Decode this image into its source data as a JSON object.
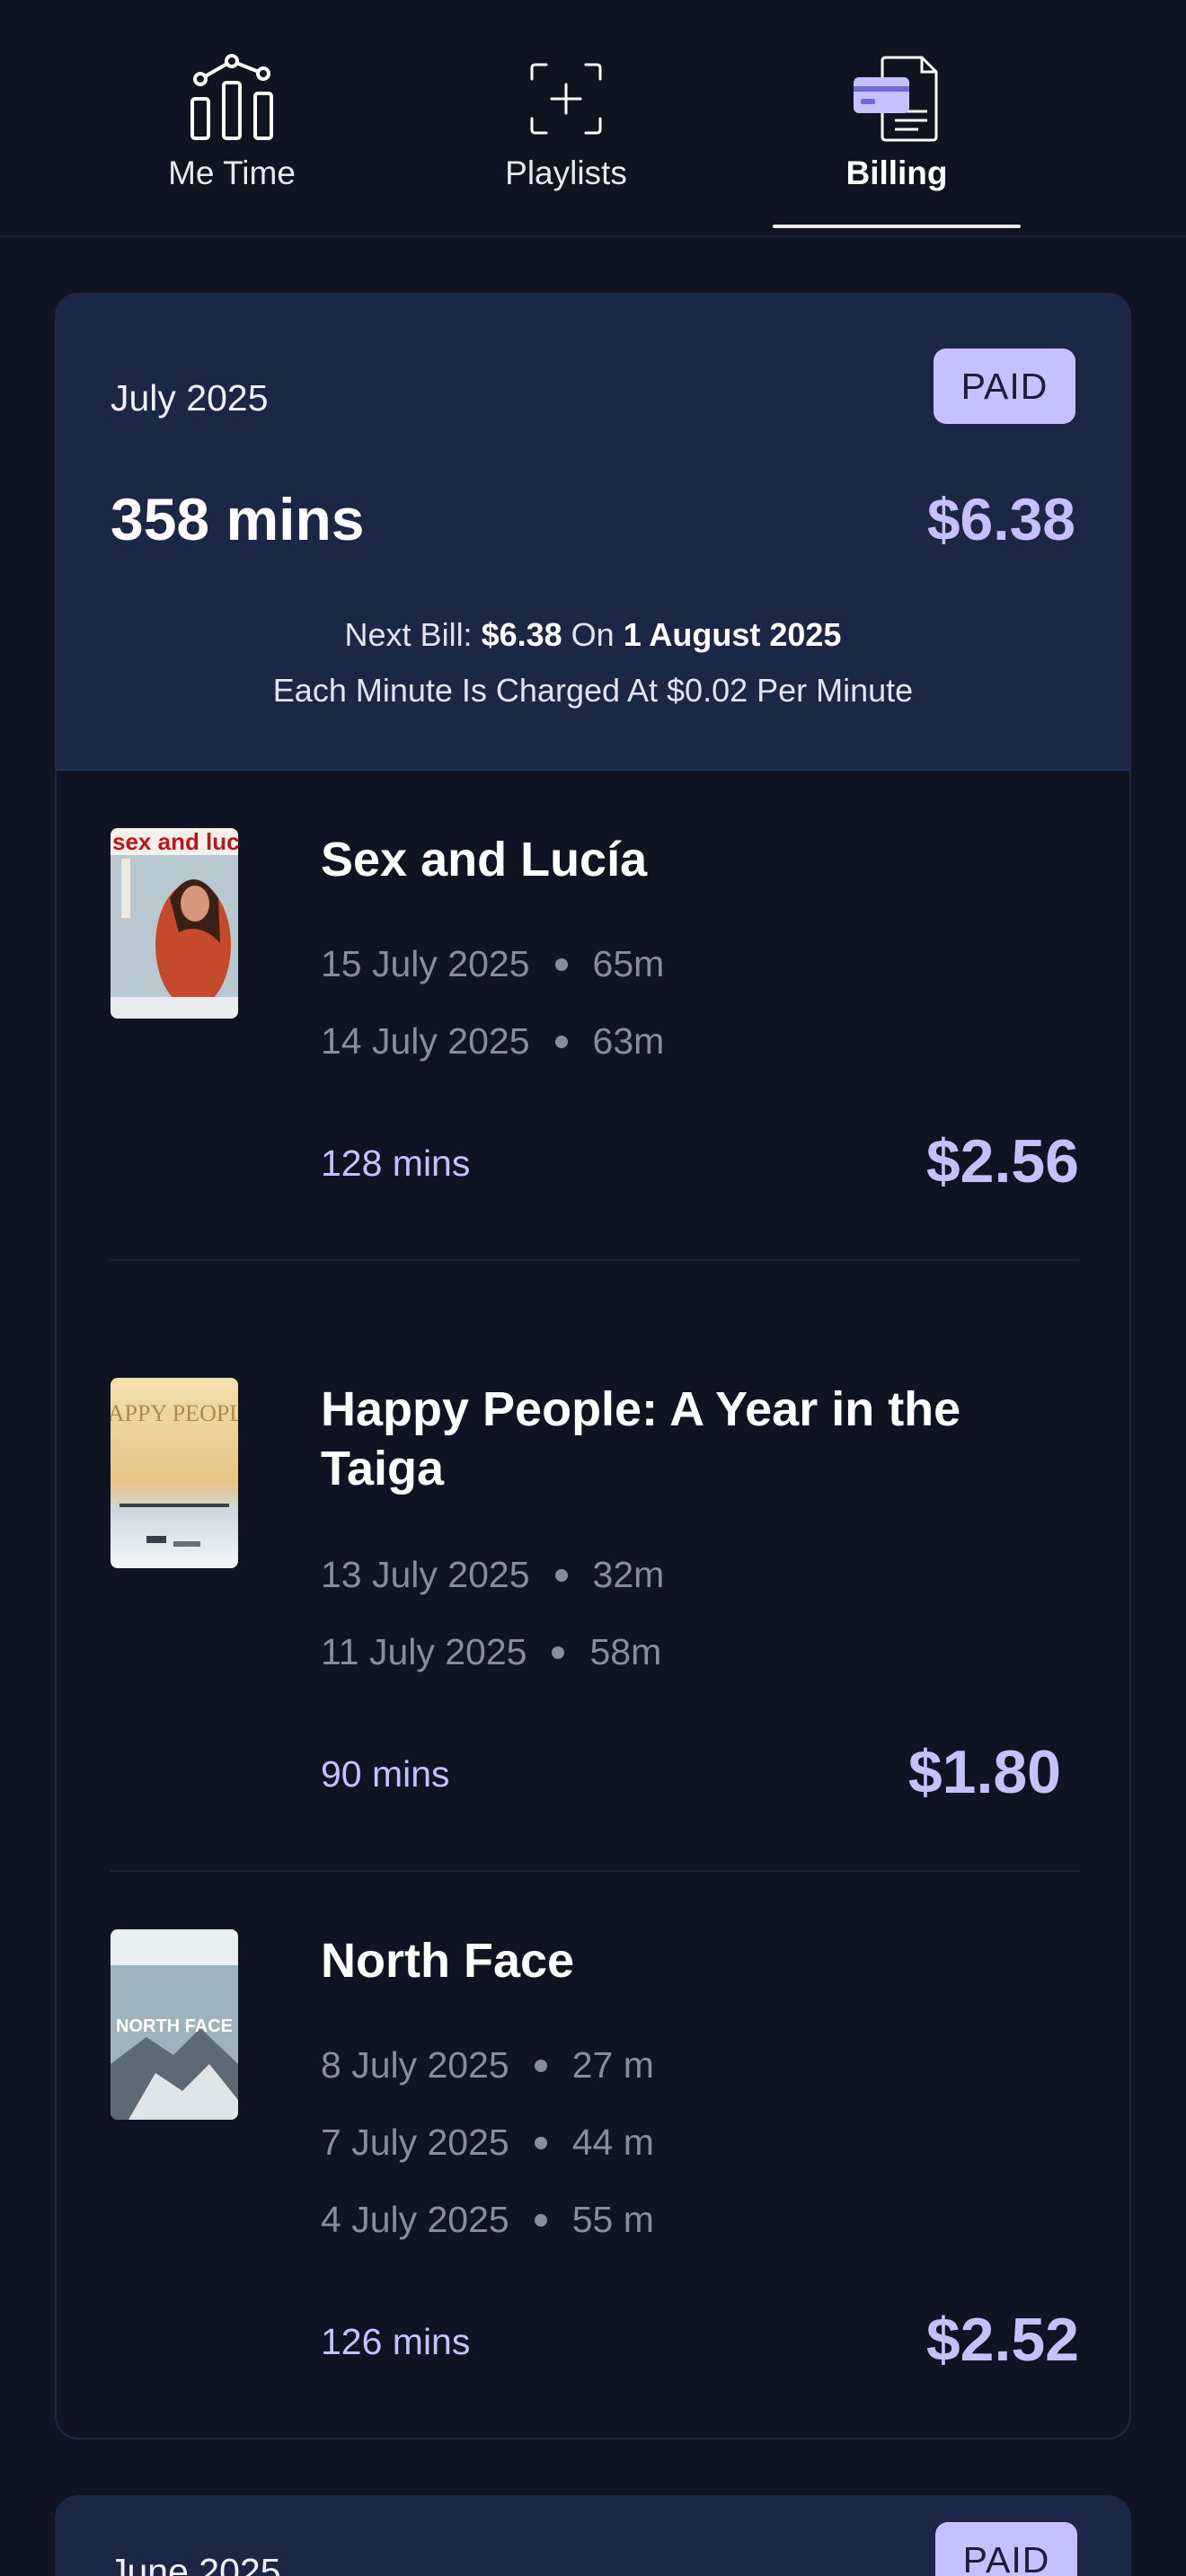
{
  "tabs": [
    {
      "label": "Me Time",
      "icon": "bar-chart-icon",
      "active": false
    },
    {
      "label": "Playlists",
      "icon": "add-playlist-icon",
      "active": false
    },
    {
      "label": "Billing",
      "icon": "billing-icon",
      "active": true
    }
  ],
  "colors": {
    "background": "#0f1322",
    "card_header": "#1a2745",
    "accent": "#c5c1ff",
    "muted_text": "#8a8d99"
  },
  "months": [
    {
      "name": "July 2025",
      "status": "PAID",
      "total_mins": "358 mins",
      "total_cost": "$6.38",
      "next_bill": {
        "prefix": "Next Bill: ",
        "amount": "$6.38",
        "on": " On ",
        "date": "1 August 2025"
      },
      "rate_text": "Each Minute Is Charged At $0.02 Per Minute",
      "films": [
        {
          "title": "Sex and Lucía",
          "poster_text": "sex and lucía",
          "sessions": [
            {
              "date": "15 July 2025",
              "duration": "65m"
            },
            {
              "date": "14 July 2025",
              "duration": "63m"
            }
          ],
          "mins": "128 mins",
          "cost": "$2.56"
        },
        {
          "title": "Happy People: A Year in the Taiga",
          "poster_text": "HAPPY PEOPLE",
          "sessions": [
            {
              "date": "13 July 2025",
              "duration": "32m"
            },
            {
              "date": "11 July 2025",
              "duration": "58m"
            }
          ],
          "mins": "90 mins",
          "cost": "$1.80"
        },
        {
          "title": "North Face",
          "poster_text": "NORTH FACE",
          "sessions": [
            {
              "date": "8 July 2025",
              "duration": "27 m"
            },
            {
              "date": "7 July 2025",
              "duration": "44 m"
            },
            {
              "date": "4 July 2025",
              "duration": "55 m"
            }
          ],
          "mins": "126 mins",
          "cost": "$2.52"
        }
      ]
    },
    {
      "name": "June 2025",
      "status": "PAID"
    }
  ]
}
